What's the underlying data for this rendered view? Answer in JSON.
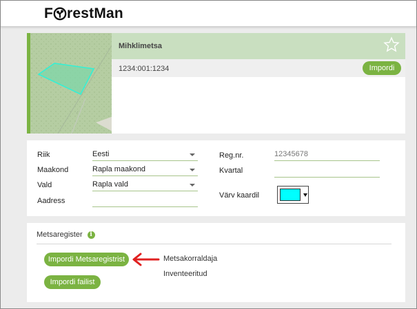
{
  "brand": {
    "name_before_icon": "F",
    "name_after_icon": "restMan"
  },
  "property": {
    "name": "Mihklimetsa",
    "code": "1234:001:1234",
    "import_label": "Impordi"
  },
  "form": {
    "riik_label": "Riik",
    "riik_value": "Eesti",
    "maakond_label": "Maakond",
    "maakond_value": "Rapla maakond",
    "vald_label": "Vald",
    "vald_value": "Rapla vald",
    "aadress_label": "Aadress",
    "aadress_value": "",
    "regnr_label": "Reg.nr.",
    "regnr_value": "12345678",
    "kvartal_label": "Kvartal",
    "kvartal_value": "",
    "varv_label": "Värv kaardil",
    "varv_value": "#00ffff"
  },
  "register": {
    "title": "Metsaregister",
    "import_register_label": "Impordi Metsaregistrist",
    "import_file_label": "Impordi failist",
    "options": [
      "Metsakorraldaja",
      "Inventeeritud"
    ]
  },
  "colors": {
    "accent": "#7bb342",
    "header_green": "#c9dfc0",
    "arrow_red": "#e02020"
  }
}
